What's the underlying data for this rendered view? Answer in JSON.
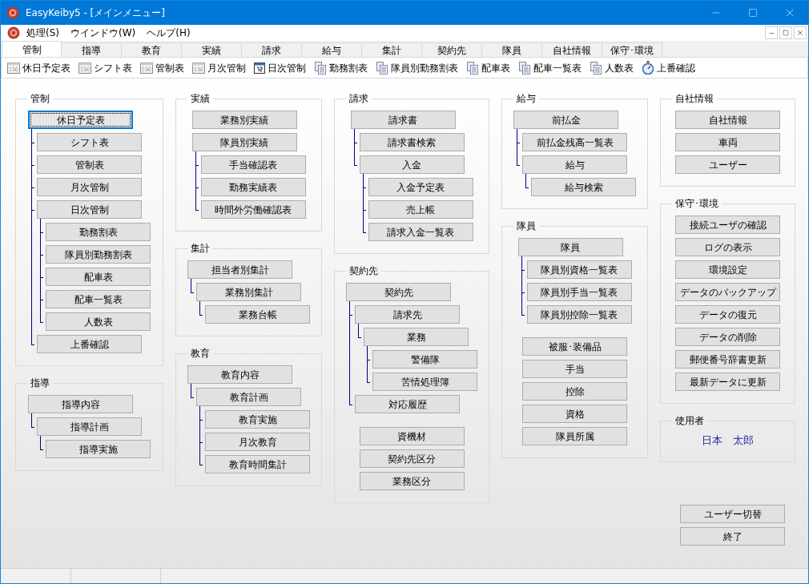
{
  "window": {
    "title": "EasyKeiby5 - [メインメニュー]"
  },
  "menu": [
    "処理(S)",
    "ウインドウ(W)",
    "ヘルプ(H)"
  ],
  "tabs": [
    {
      "label": "管制",
      "selected": true
    },
    {
      "label": "指導",
      "selected": false
    },
    {
      "label": "教育",
      "selected": false
    },
    {
      "label": "実績",
      "selected": false
    },
    {
      "label": "請求",
      "selected": false
    },
    {
      "label": "給与",
      "selected": false
    },
    {
      "label": "集計",
      "selected": false
    },
    {
      "label": "契約先",
      "selected": false
    },
    {
      "label": "隊員",
      "selected": false
    },
    {
      "label": "自社情報",
      "selected": false
    },
    {
      "label": "保守･環境",
      "selected": false
    }
  ],
  "toolbar": [
    {
      "label": "休日予定表",
      "kind": "grid"
    },
    {
      "label": "シフト表",
      "kind": "grid"
    },
    {
      "label": "管制表",
      "kind": "grid"
    },
    {
      "label": "月次管制",
      "kind": "grid"
    },
    {
      "label": "日次管制",
      "kind": "calendar"
    },
    {
      "label": "勤務割表",
      "kind": "docs"
    },
    {
      "label": "隊員別勤務割表",
      "kind": "docs"
    },
    {
      "label": "配車表",
      "kind": "docs"
    },
    {
      "label": "配車一覧表",
      "kind": "docs"
    },
    {
      "label": "人数表",
      "kind": "docs"
    },
    {
      "label": "上番確認",
      "kind": "stopwatch"
    }
  ],
  "columns": [
    [
      {
        "title": "管制",
        "items": [
          {
            "label": "休日予定表",
            "focused": true,
            "children": [
              {
                "label": "シフト表"
              },
              {
                "label": "管制表"
              },
              {
                "label": "月次管制"
              },
              {
                "label": "日次管制",
                "children": [
                  {
                    "label": "勤務割表"
                  },
                  {
                    "label": "隊員別勤務割表"
                  },
                  {
                    "label": "配車表"
                  },
                  {
                    "label": "配車一覧表"
                  },
                  {
                    "label": "人数表"
                  }
                ]
              },
              {
                "label": "上番確認"
              }
            ]
          }
        ]
      },
      {
        "title": "指導",
        "items": [
          {
            "label": "指導内容",
            "children": [
              {
                "label": "指導計画",
                "children": [
                  {
                    "label": "指導実施"
                  }
                ]
              }
            ]
          }
        ]
      }
    ],
    [
      {
        "title": "実績",
        "items": [
          {
            "label": "業務別実績"
          },
          {
            "label": "隊員別実績",
            "children": [
              {
                "label": "手当確認表"
              },
              {
                "label": "勤務実績表"
              },
              {
                "label": "時間外労働確認表"
              }
            ]
          }
        ]
      },
      {
        "title": "集計",
        "items": [
          {
            "label": "担当者別集計",
            "children": [
              {
                "label": "業務別集計",
                "children": [
                  {
                    "label": "業務台帳"
                  }
                ]
              }
            ]
          }
        ]
      },
      {
        "title": "教育",
        "items": [
          {
            "label": "教育内容",
            "children": [
              {
                "label": "教育計画",
                "children": [
                  {
                    "label": "教育実施"
                  },
                  {
                    "label": "月次教育"
                  },
                  {
                    "label": "教育時間集計"
                  }
                ]
              }
            ]
          }
        ]
      }
    ],
    [
      {
        "title": "請求",
        "items": [
          {
            "label": "請求書",
            "children": [
              {
                "label": "請求書検索"
              },
              {
                "label": "入金",
                "children": [
                  {
                    "label": "入金予定表"
                  },
                  {
                    "label": "売上帳"
                  },
                  {
                    "label": "請求入金一覧表"
                  }
                ]
              }
            ]
          }
        ]
      },
      {
        "title": "契約先",
        "items": [
          {
            "label": "契約先",
            "children": [
              {
                "label": "請求先",
                "children": [
                  {
                    "label": "業務",
                    "children": [
                      {
                        "label": "警備隊"
                      },
                      {
                        "label": "苦情処理簿"
                      }
                    ]
                  }
                ]
              },
              {
                "label": "対応履歴"
              }
            ]
          }
        ],
        "extras": [
          "資機材",
          "契約先区分",
          "業務区分"
        ]
      }
    ],
    [
      {
        "title": "給与",
        "items": [
          {
            "label": "前払金",
            "children": [
              {
                "label": "前払金残高一覧表"
              },
              {
                "label": "給与",
                "children": [
                  {
                    "label": "給与検索"
                  }
                ]
              }
            ]
          }
        ]
      },
      {
        "title": "隊員",
        "items": [
          {
            "label": "隊員",
            "children": [
              {
                "label": "隊員別資格一覧表"
              },
              {
                "label": "隊員別手当一覧表"
              },
              {
                "label": "隊員別控除一覧表"
              }
            ]
          }
        ],
        "extras": [
          "被服･装備品",
          "手当",
          "控除",
          "資格",
          "隊員所属"
        ]
      }
    ],
    [
      {
        "title": "自社情報",
        "extras": [
          "自社情報",
          "車両",
          "ユーザー"
        ]
      },
      {
        "title": "保守･環境",
        "extras": [
          "接続ユーザの確認",
          "ログの表示",
          "環境設定",
          "データのバックアップ",
          "データの復元",
          "データの削除",
          "郵便番号辞書更新",
          "最新データに更新"
        ]
      },
      {
        "title": "使用者",
        "user": "日本　太郎"
      }
    ]
  ],
  "bottom_buttons": [
    "ユーザー切替",
    "終了"
  ]
}
